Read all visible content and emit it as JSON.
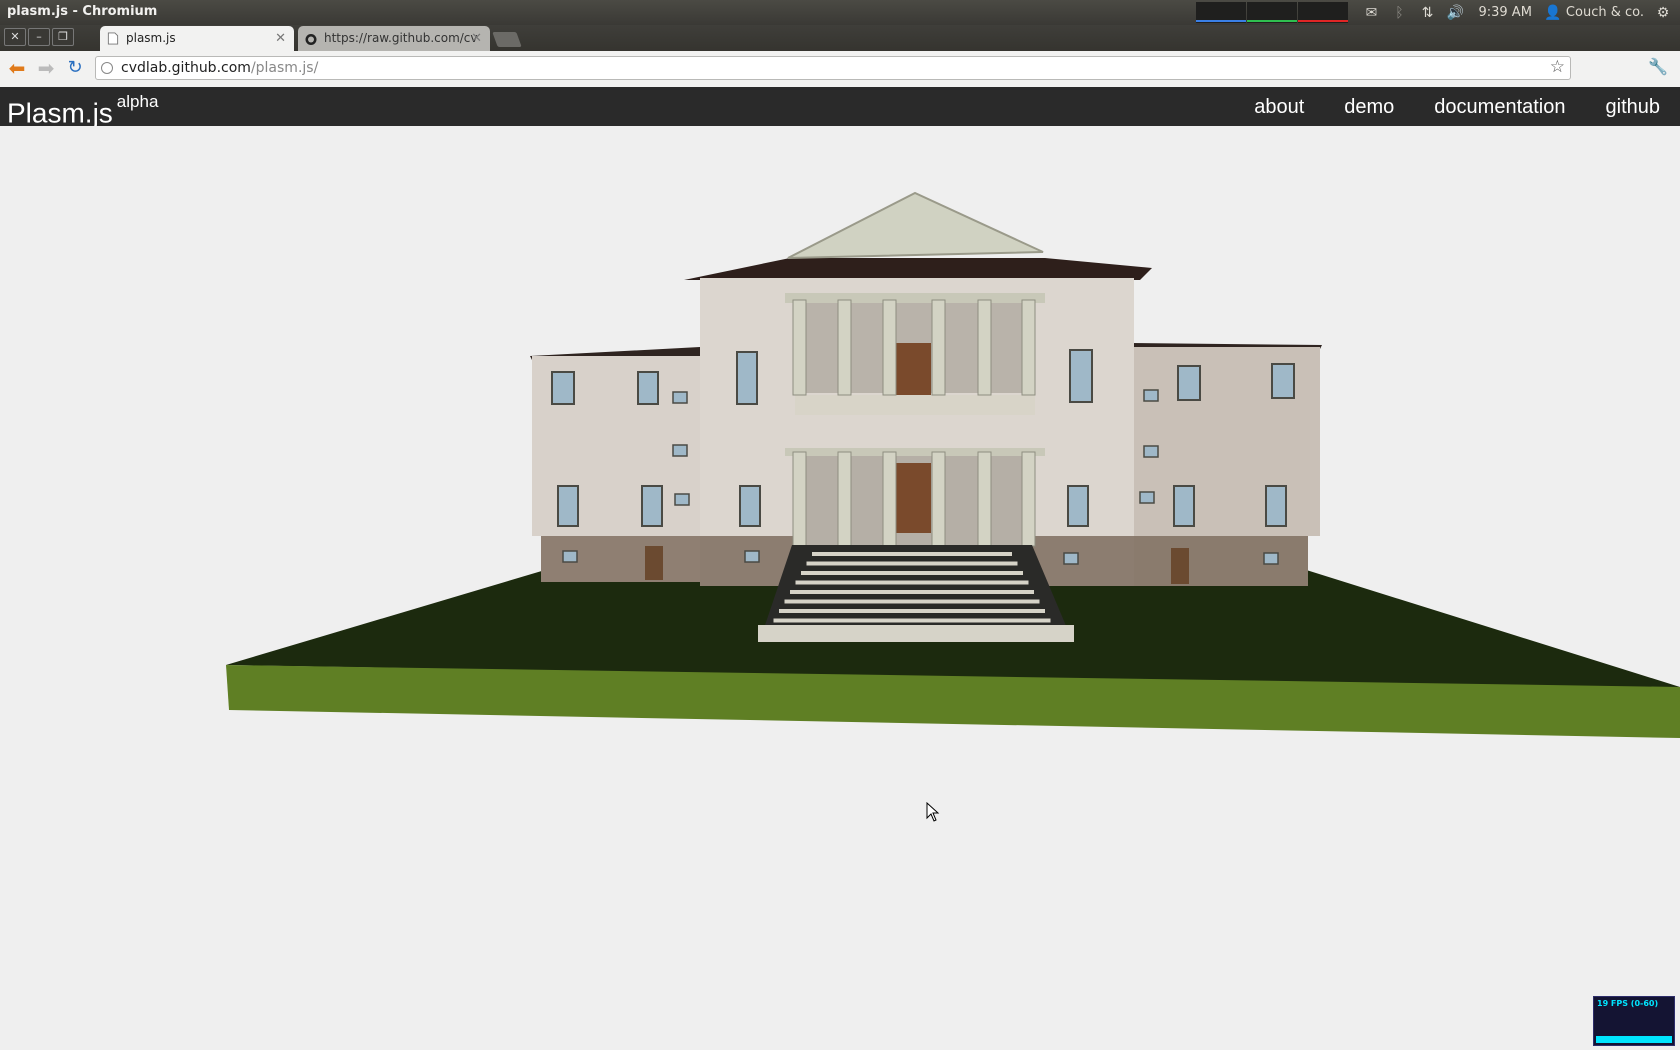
{
  "os": {
    "window_title": "plasm.js - Chromium",
    "time": "9:39 AM",
    "user": "Couch & co.",
    "sysmon_colors": [
      "#3a7fe6",
      "#2fbf4f",
      "#e02525"
    ]
  },
  "browser": {
    "tabs": [
      {
        "title": "plasm.js",
        "icon": "page-icon",
        "active": true
      },
      {
        "title": "https://raw.github.com/cv",
        "icon": "github-icon",
        "active": false
      }
    ],
    "url_host": "cvdlab.github.com",
    "url_path": "/plasm.js/"
  },
  "site": {
    "brand": "Plasm.js",
    "brand_tag": "alpha",
    "nav": [
      "about",
      "demo",
      "documentation",
      "github"
    ]
  },
  "scene": {
    "description": "3D model of a Palladian villa rendered with WebGL",
    "colors": {
      "wall": "#d6d0c8",
      "plinth": "#8f7f72",
      "roof": "#3a2a25",
      "lawn_top": "#1c2a0e",
      "lawn_side": "#5f7f24",
      "column": "#d3d3c4"
    }
  },
  "fps_meter": {
    "label": "19 FPS (0-60)",
    "color": "#00e5ff"
  }
}
